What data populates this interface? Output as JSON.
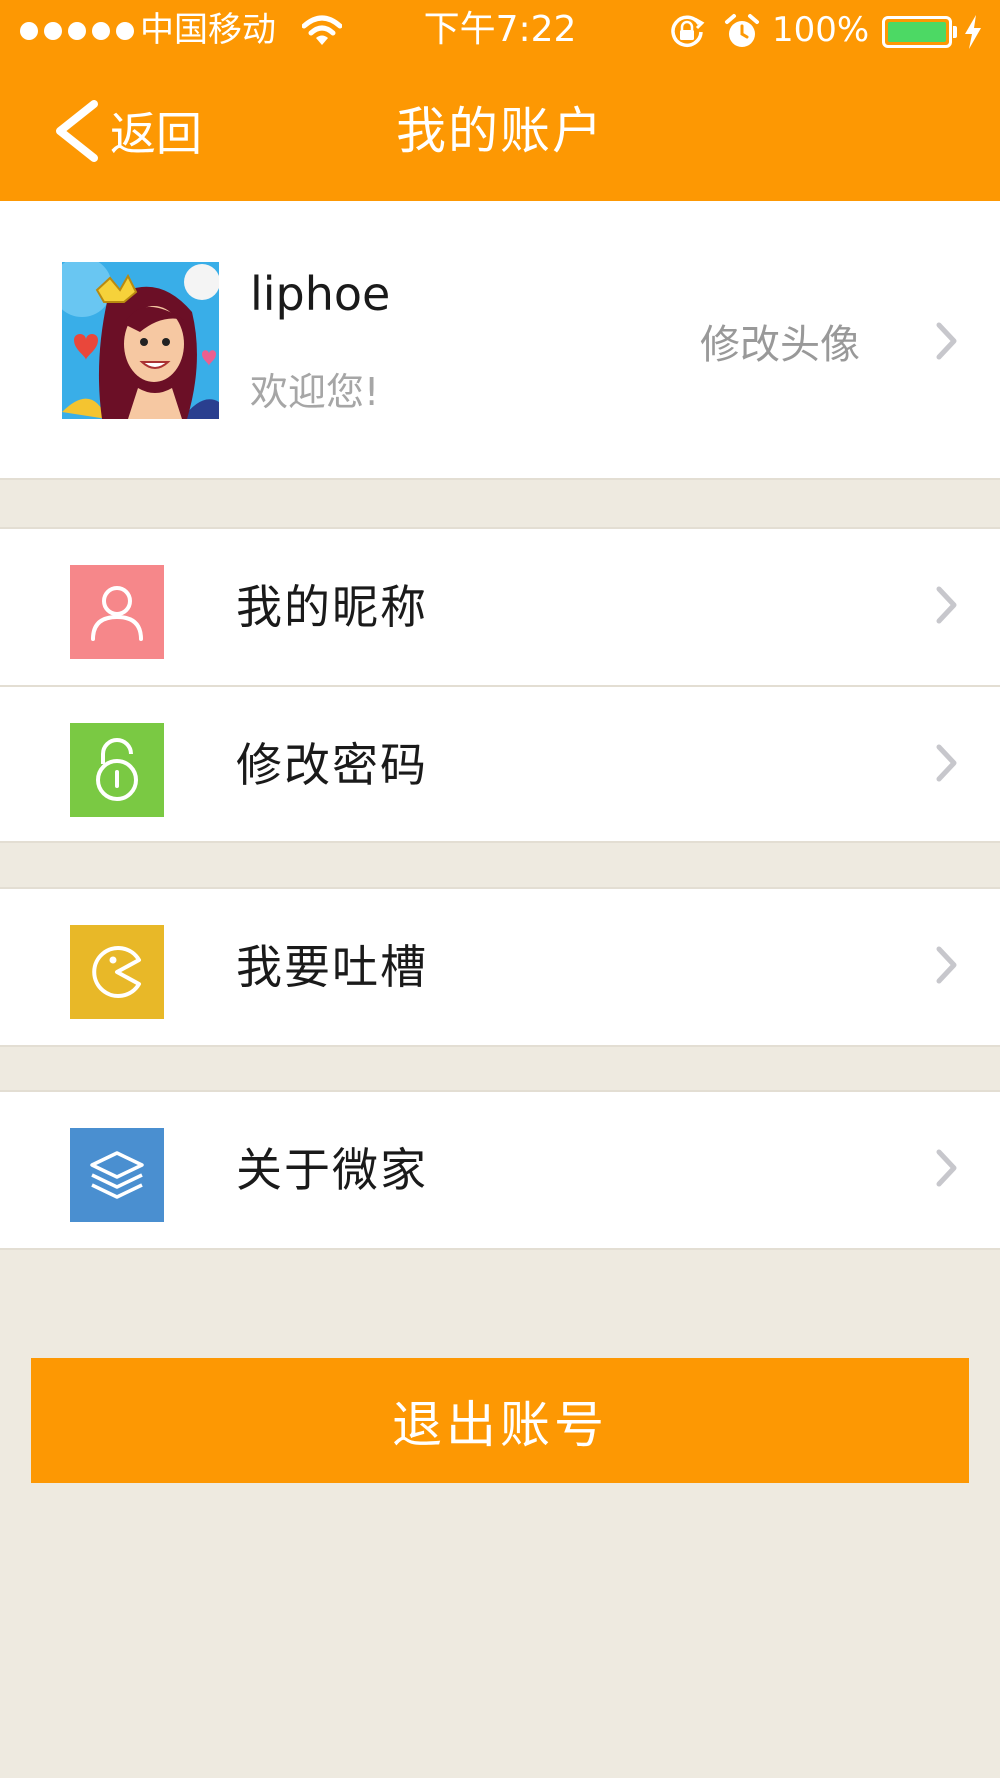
{
  "status_bar": {
    "carrier": "中国移动",
    "time": "下午7:22",
    "battery_percent": "100%",
    "battery_level": 1.0
  },
  "nav": {
    "back_label": "返回",
    "title": "我的账户"
  },
  "profile": {
    "username": "liphoe",
    "greeting": "欢迎您!",
    "change_avatar_label": "修改头像"
  },
  "menu": {
    "nickname": {
      "label": "我的昵称",
      "icon": "person-icon",
      "color": "#f6878a"
    },
    "password": {
      "label": "修改密码",
      "icon": "padlock-icon",
      "color": "#7ac943"
    },
    "feedback": {
      "label": "我要吐槽",
      "icon": "chomp-icon",
      "color": "#e8b828"
    },
    "about": {
      "label": "关于微家",
      "icon": "layers-icon",
      "color": "#4a8fd0"
    }
  },
  "logout": {
    "label": "退出账号"
  },
  "colors": {
    "brand_orange": "#fd9803",
    "page_background": "#eeeae0",
    "divider": "#e3ded3",
    "secondary_text": "#a6a6a6"
  }
}
